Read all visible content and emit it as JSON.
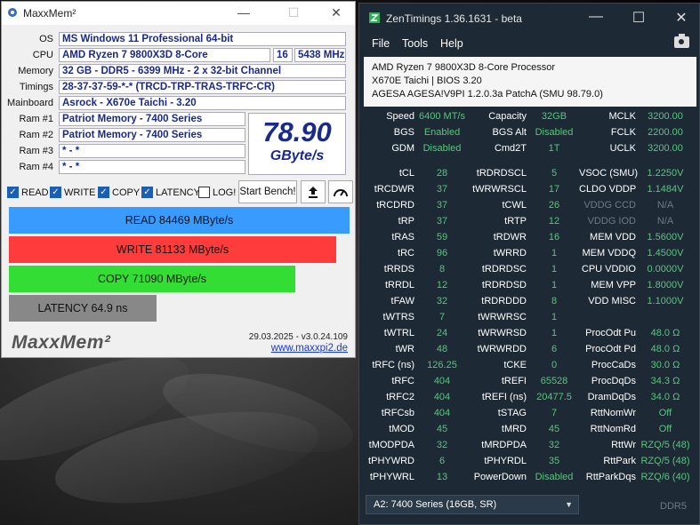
{
  "maxxmem": {
    "title": "MaxxMem²",
    "rows": [
      {
        "label": "OS",
        "value": "MS Windows 11 Professional 64-bit"
      },
      {
        "label": "CPU",
        "value": "AMD Ryzen 7 9800X3D 8-Core",
        "cores": "16",
        "clock": "5438 MHz"
      },
      {
        "label": "Memory",
        "value": "32 GB - DDR5 - 6399 MHz - 2 x 32-bit Channel"
      },
      {
        "label": "Timings",
        "value": "28-37-37-59-*-* (TRCD-TRP-TRAS-TRFC-CR)"
      },
      {
        "label": "Mainboard",
        "value": "Asrock - X670e Taichi - 3.20"
      },
      {
        "label": "Ram #1",
        "value": "Patriot Memory - 7400 Series"
      },
      {
        "label": "Ram #2",
        "value": "Patriot Memory - 7400 Series"
      },
      {
        "label": "Ram #3",
        "value": "* - *"
      },
      {
        "label": "Ram #4",
        "value": "* - *"
      }
    ],
    "score": "78.90",
    "score_unit": "GByte/s",
    "checks": [
      {
        "label": "READ",
        "checked": true
      },
      {
        "label": "WRITE",
        "checked": true
      },
      {
        "label": "COPY",
        "checked": true
      },
      {
        "label": "LATENCY",
        "checked": true
      },
      {
        "label": "LOG!",
        "checked": false
      }
    ],
    "start_label": "Start Bench!",
    "bars": [
      {
        "label": "READ  84469  MByte/s",
        "fraction": 1.0,
        "color": "#3a9bff"
      },
      {
        "label": "WRITE  81133  MByte/s",
        "fraction": 0.96,
        "color": "#ff3c3c"
      },
      {
        "label": "COPY  71090  MByte/s",
        "fraction": 0.84,
        "color": "#33dd33"
      },
      {
        "label": "LATENCY  64.9  ns",
        "fraction": 0.43,
        "color": "#888888"
      }
    ],
    "footer": {
      "logo": "MaxxMem²",
      "date": "29.03.2025 - v3.0.24.109",
      "url": "www.maxxpi2.de"
    }
  },
  "zentimings": {
    "title": "ZenTimings 1.36.1631 - beta",
    "menu": [
      "File",
      "Tools",
      "Help"
    ],
    "info": [
      "AMD Ryzen 7 9800X3D 8-Core Processor",
      "X670E Taichi | BIOS 3.20",
      "AGESA AGESA!V9PI 1.2.0.3a PatchA (SMU 98.79.0)"
    ],
    "top": [
      [
        "Speed",
        "6400 MT/s",
        "Capacity",
        "32GB",
        "MCLK",
        "3200.00"
      ],
      [
        "BGS",
        "Enabled",
        "BGS Alt",
        "Disabled",
        "FCLK",
        "2200.00"
      ],
      [
        "GDM",
        "Disabled",
        "Cmd2T",
        "1T",
        "UCLK",
        "3200.00"
      ]
    ],
    "rows": [
      [
        "tCL",
        "28",
        "tRDRDSCL",
        "5",
        "VSOC (SMU)",
        "1.2250V"
      ],
      [
        "tRCDWR",
        "37",
        "tWRWRSCL",
        "17",
        "CLDO VDDP",
        "1.1484V"
      ],
      [
        "tRCDRD",
        "37",
        "tCWL",
        "26",
        "VDDG CCD",
        "N/A"
      ],
      [
        "tRP",
        "37",
        "tRTP",
        "12",
        "VDDG IOD",
        "N/A"
      ],
      [
        "tRAS",
        "59",
        "tRDWR",
        "16",
        "MEM VDD",
        "1.5600V"
      ],
      [
        "tRC",
        "96",
        "tWRRD",
        "1",
        "MEM VDDQ",
        "1.4500V"
      ],
      [
        "tRRDS",
        "8",
        "tRDRDSC",
        "1",
        "CPU VDDIO",
        "0.0000V"
      ],
      [
        "tRRDL",
        "12",
        "tRDRDSD",
        "1",
        "MEM VPP",
        "1.8000V"
      ],
      [
        "tFAW",
        "32",
        "tRDRDDD",
        "8",
        "VDD MISC",
        "1.1000V"
      ],
      [
        "tWTRS",
        "7",
        "tWRWRSC",
        "1",
        "",
        ""
      ],
      [
        "tWTRL",
        "24",
        "tWRWRSD",
        "1",
        "ProcOdt Pu",
        "48.0 Ω"
      ],
      [
        "tWR",
        "48",
        "tWRWRDD",
        "6",
        "ProcOdt Pd",
        "48.0 Ω"
      ],
      [
        "tRFC (ns)",
        "126.25",
        "tCKE",
        "0",
        "ProcCaDs",
        "30.0 Ω"
      ],
      [
        "tRFC",
        "404",
        "tREFI",
        "65528",
        "ProcDqDs",
        "34.3 Ω"
      ],
      [
        "tRFC2",
        "404",
        "tREFI (ns)",
        "20477.5",
        "DramDqDs",
        "34.0 Ω"
      ],
      [
        "tRFCsb",
        "404",
        "tSTAG",
        "7",
        "RttNomWr",
        "Off"
      ],
      [
        "tMOD",
        "45",
        "tMRD",
        "45",
        "RttNomRd",
        "Off"
      ],
      [
        "tMODPDA",
        "32",
        "tMRDPDA",
        "32",
        "RttWr",
        "RZQ/5 (48)"
      ],
      [
        "tPHYWRD",
        "6",
        "tPHYRDL",
        "35",
        "RttPark",
        "RZQ/5 (48)"
      ],
      [
        "tPHYWRL",
        "13",
        "PowerDown",
        "Disabled",
        "RttParkDqs",
        "RZQ/6 (40)"
      ]
    ],
    "dim_labels": [
      "VDDG CCD",
      "VDDG IOD"
    ],
    "selector": "A2: 7400 Series (16GB, SR)",
    "ddr": "DDR5"
  },
  "colors": {
    "zen_bg": "#1d2a35",
    "zen_value": "#56c77a",
    "maxx_text": "#1a2a8a"
  }
}
